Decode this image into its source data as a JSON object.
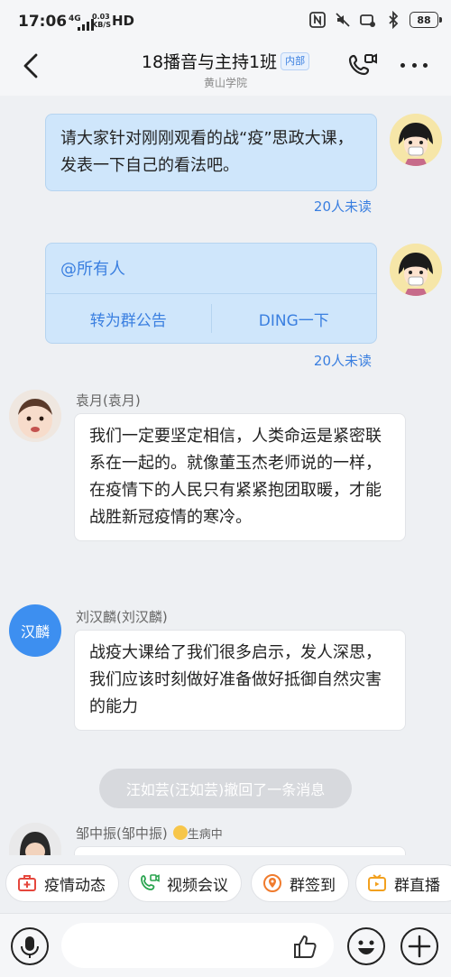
{
  "status_bar": {
    "time": "17:06",
    "network": "4G",
    "speed_value": "0.03",
    "speed_unit": "KB/S",
    "hd": "HD",
    "battery": "88"
  },
  "header": {
    "title": "18播音与主持1班",
    "badge": "内部",
    "subtitle": "黄山学院"
  },
  "messages": {
    "m1": {
      "text": "请大家针对刚刚观看的战“疫”思政大课，发表一下自己的看法吧。",
      "unread": "20人未读"
    },
    "m2": {
      "text": "@所有人",
      "action_announce": "转为群公告",
      "action_ding": "DING一下",
      "unread": "20人未读"
    },
    "m3": {
      "sender": "袁月(袁月)",
      "text": "我们一定要坚定相信，人类命运是紧密联系在一起的。就像董玉杰老师说的一样，在疫情下的人民只有紧紧抱团取暖，才能战胜新冠疫情的寒冷。"
    },
    "m4": {
      "sender": "刘汉麟(刘汉麟)",
      "avatar_text": "汉麟",
      "text": "战疫大课给了我们很多启示，发人深思，我们应该时刻做好准备做好抵御自然灾害的能力"
    },
    "recall": "汪如芸(汪如芸)撤回了一条消息",
    "m5": {
      "sender": "邹中振(邹中振)",
      "status": "生病中"
    }
  },
  "quick_actions": [
    {
      "label": "疫情动态",
      "icon": "medical-kit-icon",
      "color": "#e5473d"
    },
    {
      "label": "视频会议",
      "icon": "video-phone-icon",
      "color": "#2aa44f"
    },
    {
      "label": "群签到",
      "icon": "location-pin-icon",
      "color": "#f07b2d"
    },
    {
      "label": "群直播",
      "icon": "tv-live-icon",
      "color": "#f2a01e"
    }
  ],
  "input": {
    "placeholder": ""
  },
  "colors": {
    "accent": "#3a7fe0",
    "bubble_out": "#cfe6fb",
    "avatar_blue": "#3d8ff0"
  }
}
